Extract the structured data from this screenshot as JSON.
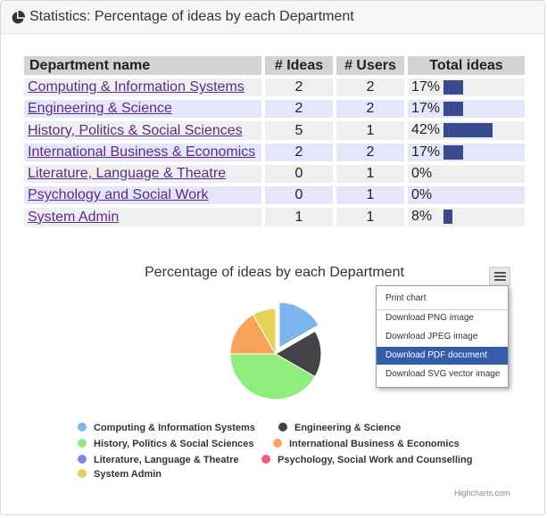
{
  "panel": {
    "title": "Statistics: Percentage of ideas by each Department"
  },
  "table": {
    "headers": [
      "Department name",
      "# Ideas",
      "# Users",
      "Total ideas"
    ],
    "rows": [
      {
        "department": "Computing & Information Systems",
        "ideas": "2",
        "users": "2",
        "pct_label": "17%",
        "pct": 17
      },
      {
        "department": "Engineering & Science",
        "ideas": "2",
        "users": "2",
        "pct_label": "17%",
        "pct": 17
      },
      {
        "department": "History, Politics & Social Sciences",
        "ideas": "5",
        "users": "1",
        "pct_label": "42%",
        "pct": 42
      },
      {
        "department": "International Business & Economics",
        "ideas": "2",
        "users": "2",
        "pct_label": "17%",
        "pct": 17
      },
      {
        "department": "Literature, Language & Theatre",
        "ideas": "0",
        "users": "1",
        "pct_label": "0%",
        "pct": 0
      },
      {
        "department": "Psychology and Social Work",
        "ideas": "0",
        "users": "1",
        "pct_label": "0%",
        "pct": 0
      },
      {
        "department": "System Admin",
        "ideas": "1",
        "users": "1",
        "pct_label": "8%",
        "pct": 8
      }
    ],
    "bar_color": "#3a4a8e"
  },
  "chart": {
    "title": "Percentage of ideas by each Department",
    "credits": "Highcharts.com",
    "menu": {
      "items": [
        "Print chart",
        "Download PNG image",
        "Download JPEG image",
        "Download PDF document",
        "Download SVG vector image"
      ],
      "active_index": 3
    }
  },
  "chart_data": {
    "type": "pie",
    "title": "Percentage of ideas by each Department",
    "categories": [
      "Computing & Information Systems",
      "Engineering & Science",
      "History, Politics & Social Sciences",
      "International Business & Economics",
      "Literature, Language & Theatre",
      "Psychology, Social Work and Counselling",
      "System Admin"
    ],
    "values": [
      2,
      2,
      5,
      2,
      0,
      0,
      1
    ],
    "colors": [
      "#7cb5ec",
      "#434348",
      "#90ed7d",
      "#f7a35c",
      "#8085e9",
      "#f15c80",
      "#e4d354"
    ],
    "sliced": [
      true,
      false,
      false,
      false,
      false,
      false,
      false
    ],
    "legend": "bottom"
  }
}
